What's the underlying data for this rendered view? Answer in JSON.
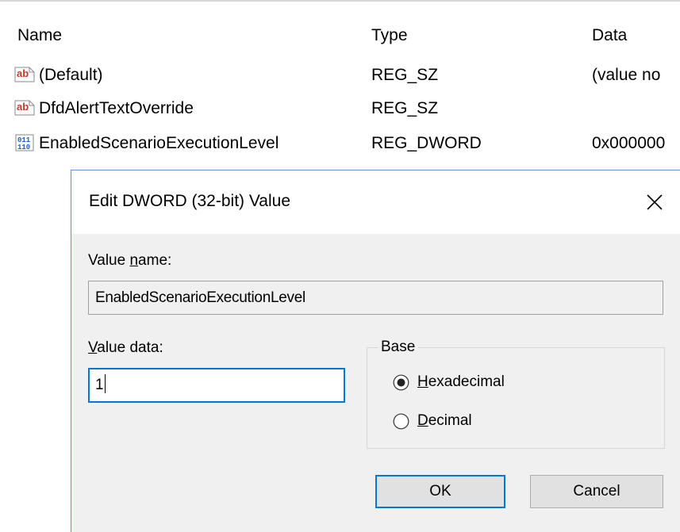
{
  "list": {
    "headers": {
      "name": "Name",
      "type": "Type",
      "data": "Data"
    },
    "rows": [
      {
        "icon": "string-value-icon",
        "name": "(Default)",
        "type": "REG_SZ",
        "data": "(value no"
      },
      {
        "icon": "string-value-icon",
        "name": "DfdAlertTextOverride",
        "type": "REG_SZ",
        "data": ""
      },
      {
        "icon": "binary-value-icon",
        "name": "EnabledScenarioExecutionLevel",
        "type": "REG_DWORD",
        "data": "0x000000"
      }
    ]
  },
  "dialog": {
    "title": "Edit DWORD (32-bit) Value",
    "value_name_label_pre": "Value ",
    "value_name_label_key": "n",
    "value_name_label_post": "ame:",
    "value_name": "EnabledScenarioExecutionLevel",
    "value_data_label_key": "V",
    "value_data_label_post": "alue data:",
    "value_data": "1",
    "base": {
      "legend": "Base",
      "options": [
        {
          "key": "H",
          "rest": "exadecimal",
          "selected": true
        },
        {
          "key": "D",
          "rest": "ecimal",
          "selected": false
        }
      ]
    },
    "ok_label": "OK",
    "cancel_label": "Cancel"
  },
  "colors": {
    "accent": "#0078d7",
    "dialog_background": "#f0f0f0",
    "dialog_border": "#6b8fd8"
  }
}
